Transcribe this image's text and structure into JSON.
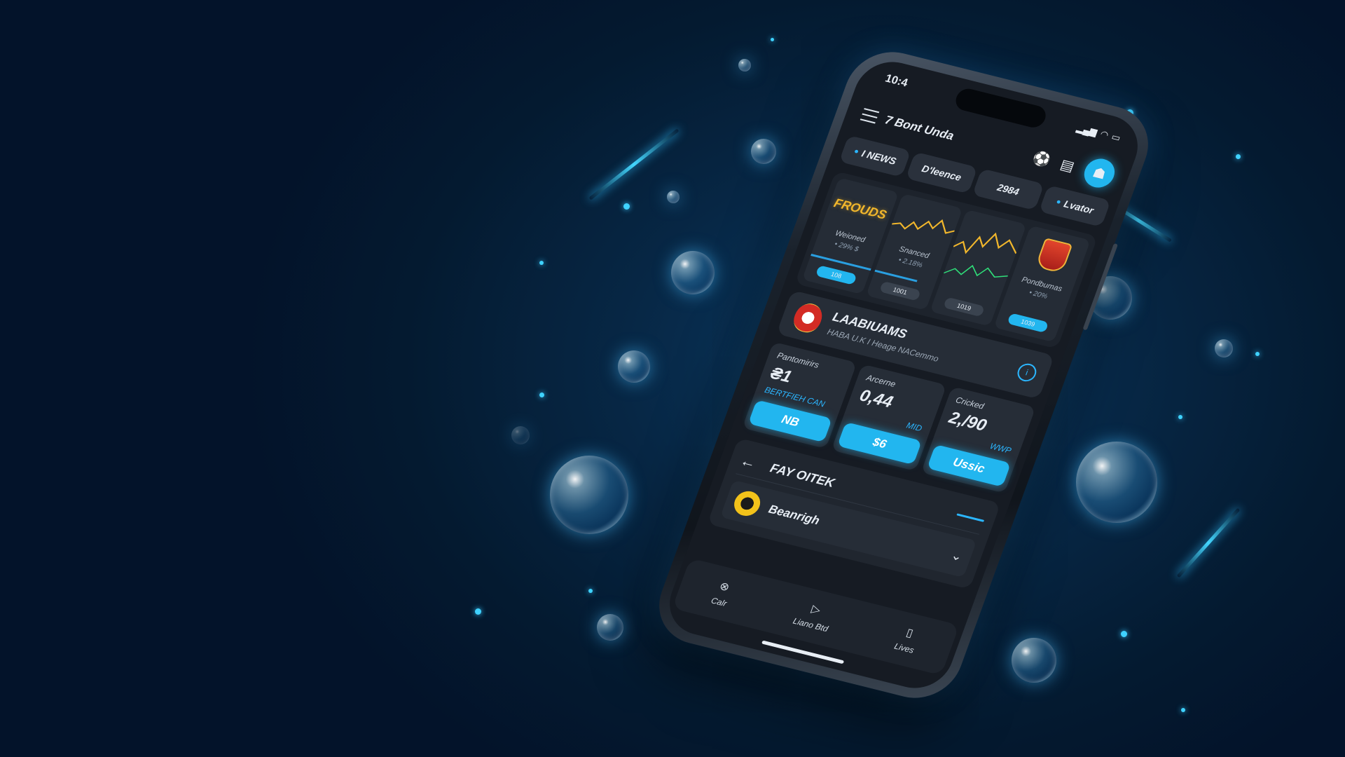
{
  "status": {
    "time": "10:4",
    "signal": "▂▄▆",
    "wifi": "◠",
    "battery": "▭"
  },
  "app": {
    "title": "7 Bont Unda"
  },
  "header_icons": {
    "ball": "⚽",
    "ticket": "▤",
    "avatar": "☗"
  },
  "tabs": [
    {
      "label": "I NEWS",
      "dot": "●"
    },
    {
      "label": "D'leence",
      "dot": ""
    },
    {
      "label": "2984",
      "dot": ""
    },
    {
      "label": "Lvator",
      "dot": "●"
    }
  ],
  "cards": [
    {
      "logo": "FROUDS",
      "label": "Weioned",
      "value": "• 29% $",
      "chip": "108"
    },
    {
      "logo": "",
      "label": "Snanced",
      "value": "• 2.18%",
      "chip": "1001"
    },
    {
      "logo": "",
      "label": "",
      "value": "",
      "chip": "1019"
    },
    {
      "logo": "",
      "label": "Pondbumas",
      "value": "• 20%",
      "chip": "1039"
    }
  ],
  "match": {
    "title": "LAABIUAMS",
    "subtitle": "HABA U.K I Heage NACemmo",
    "info": "i"
  },
  "odds": [
    {
      "label": "Pantomirirs",
      "value": "₴1",
      "sub": "BERTFIEH CAN",
      "button": "NB"
    },
    {
      "label": "Arcerne",
      "value": "0,44",
      "sub": "MID",
      "button": "$6"
    },
    {
      "label": "Cricked",
      "value": "2,/90",
      "sub": "WWP",
      "button": "Ussic"
    }
  ],
  "section": {
    "title": "FAY OITEK",
    "row_label": "Beanrigh"
  },
  "nav": [
    {
      "icon": "⊗",
      "label": "Calr"
    },
    {
      "icon": "▷",
      "label": "Liano Btd"
    },
    {
      "icon": "▯",
      "label": "Lives"
    }
  ],
  "colors": {
    "accent": "#22b6ef",
    "background": "#041a30",
    "gold": "#f2b72c",
    "screen": "#161b23"
  }
}
